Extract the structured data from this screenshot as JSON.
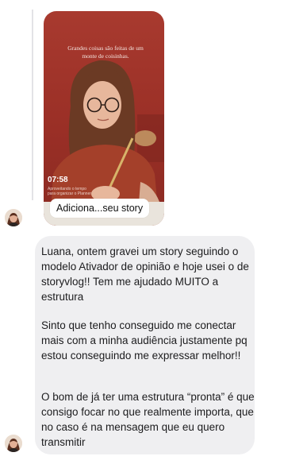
{
  "story": {
    "overlay_text": "Grandes coisas são feitas de um monte de coisinhas.",
    "time": "07:58",
    "caption_line1": "Aproveitando o tempo",
    "caption_line2": "para organizar o Planner",
    "label": "Adiciona...seu story"
  },
  "message": {
    "paragraphs": [
      "Luana, ontem gravei um story seguindo o modelo Ativador de opinião e hoje usei o de storyvlog!! Tem me ajudado MUITO a estrutura",
      "Sinto que tenho conseguido me conectar mais com a minha audiência justamente pq estou conseguindo me expressar melhor!!",
      "O bom de já ter uma estrutura “pronta” é que consigo focar no que realmente importa, que no caso é na mensagem que eu quero transmitir"
    ]
  },
  "colors": {
    "bubble": "#efeff1",
    "story_background": "#a83a2f"
  }
}
